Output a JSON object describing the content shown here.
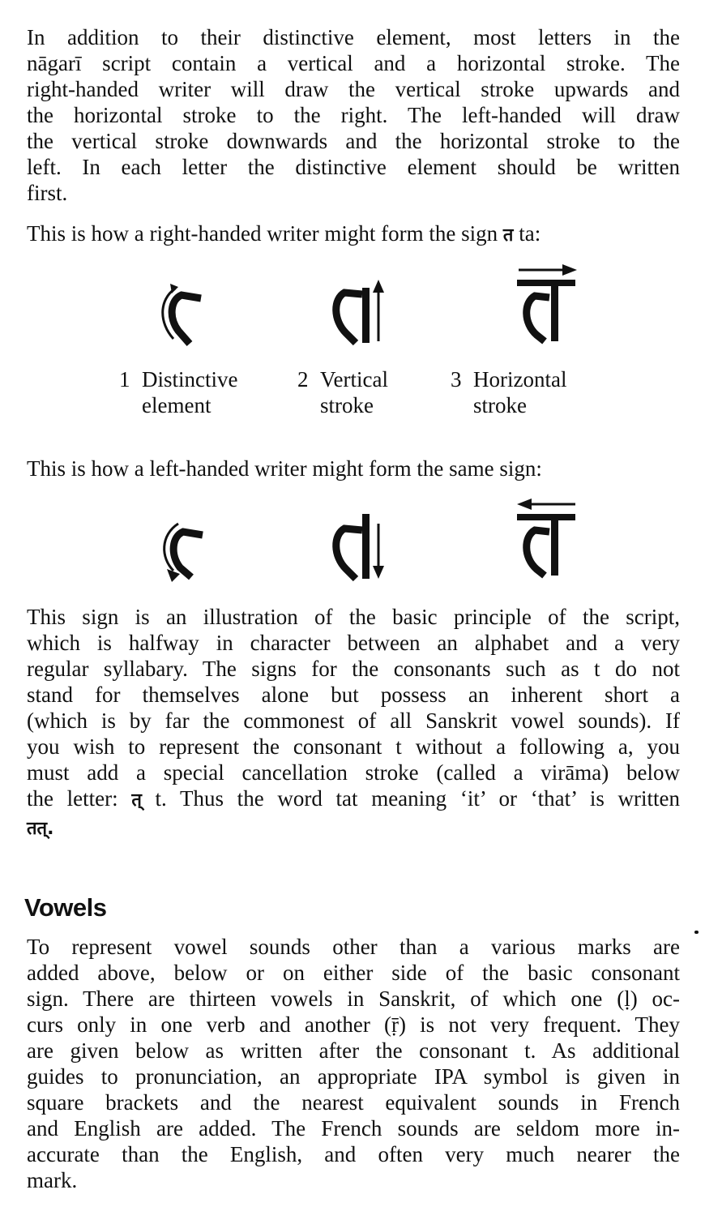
{
  "intro_paragraph": {
    "lines": [
      "In addition to their distinctive element, most letters in the",
      "nāgarī script contain a vertical and a horizontal stroke. The",
      "right-handed writer will draw the vertical stroke upwards and",
      "the horizontal stroke to the right. The left-handed will draw",
      "the vertical stroke downwards and the horizontal stroke to the",
      "left. In each letter the distinctive element should be written",
      "first."
    ]
  },
  "right_handed": {
    "intro_before": "This is how a right-handed writer might form the sign ",
    "intro_sign": "त",
    "intro_after": " ta:",
    "steps": [
      {
        "number": "1",
        "line1": "Distinctive",
        "line2": "element"
      },
      {
        "number": "2",
        "line1": "Vertical",
        "line2": "stroke"
      },
      {
        "number": "3",
        "line1": "Horizontal",
        "line2": "stroke"
      }
    ]
  },
  "left_handed": {
    "intro": "This is how a left-handed writer might form the same sign:"
  },
  "virama_paragraph": {
    "lines": [
      "This sign is an illustration of the basic principle of the script,",
      "which is halfway in character between an alphabet and a very",
      "regular syllabary. The signs for the consonants such as t do not",
      "stand for themselves alone but possess an inherent short a",
      "(which is by far the commonest of all Sanskrit vowel sounds). If",
      "you wish to represent the consonant t without a following a, you",
      "must add a special cancellation stroke (called a virāma) below"
    ],
    "line8_before": "the letter: ",
    "line8_sign": "त्",
    "line8_after": " t. Thus the word tat meaning ‘it’ or ‘that’ is written",
    "line9_sign": "तत्."
  },
  "vowels_heading": "Vowels",
  "vowels_paragraph": {
    "lines": [
      "To represent vowel sounds other than a various marks are",
      "added above, below or on either side of the basic consonant",
      "sign. There are thirteen vowels in Sanskrit, of which one (ḷ) oc-",
      "curs only in one verb and another (ṝ) is not very frequent. They",
      "are given below as written after the consonant t. As additional",
      "guides to pronunciation, an appropriate IPA symbol is given in",
      "square brackets and the nearest equivalent sounds in French",
      "and English are added. The French sounds are seldom more in-",
      "accurate than the English, and often very much nearer the",
      "mark."
    ]
  }
}
